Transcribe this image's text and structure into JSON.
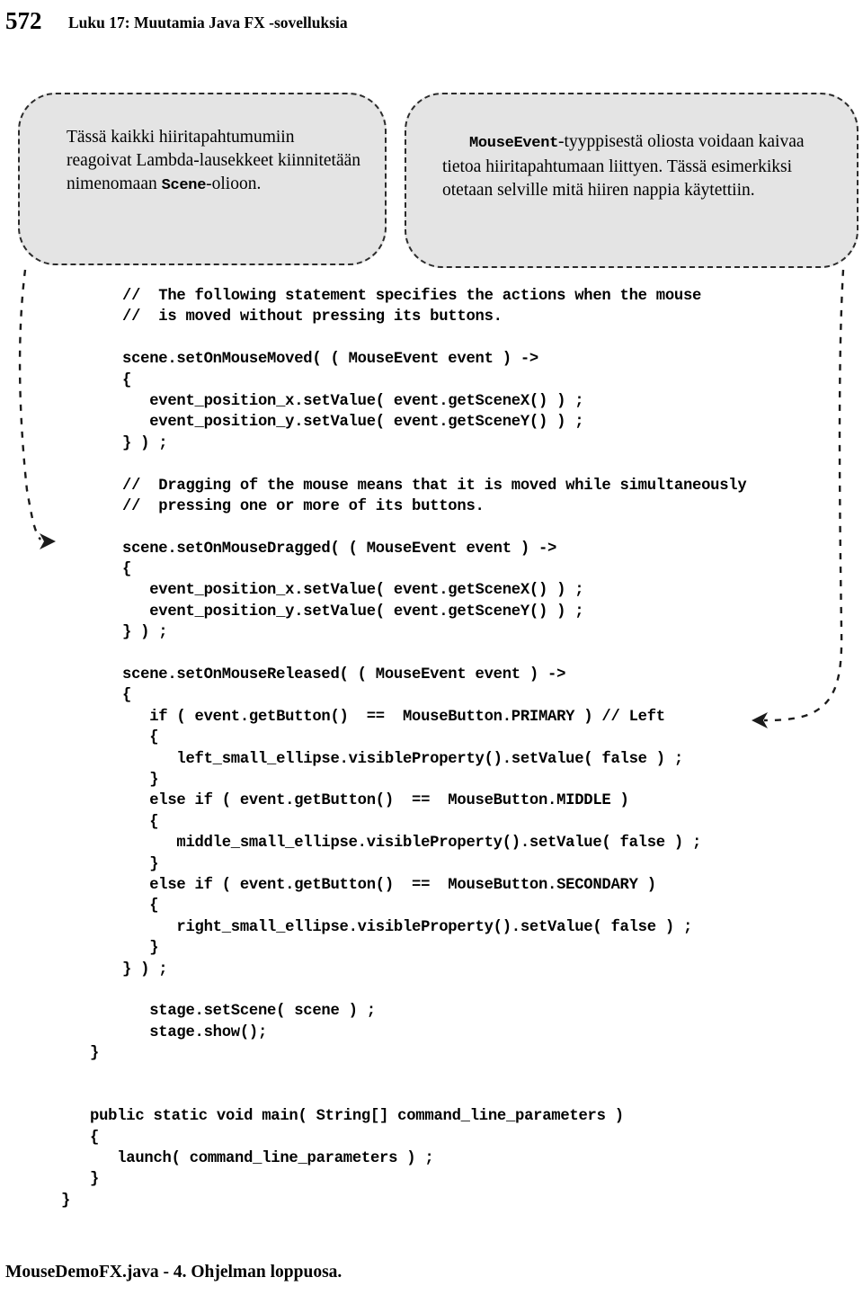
{
  "page": {
    "number": "572",
    "header_title": "Luku 17: Muutamia Java FX -sovelluksia",
    "footer_caption": "MouseDemoFX.java - 4.  Ohjelman loppuosa."
  },
  "callouts": {
    "left": {
      "text_part1": "    Tässä kaikki hiiritapahtumumiin reagoivat Lambda-lausekkeet kiinnitetään nimenomaan ",
      "code_term": "Scene",
      "text_part2": "-olioon."
    },
    "right": {
      "code_term": "MouseEvent",
      "text_part2": "-tyyppisestä oliosta voidaan kaivaa tietoa hiiritapahtumaan liittyen. Tässä esimerkiksi otetaan selville mitä hiiren nappia käytettiin."
    }
  },
  "code": {
    "lines": [
      {
        "text": "//  The following statement specifies the actions when the mouse",
        "indent": 0
      },
      {
        "text": "//  is moved without pressing its buttons.",
        "indent": 0
      },
      {
        "text": "",
        "indent": 0
      },
      {
        "text": "scene.setOnMouseMoved( ( MouseEvent event ) ->",
        "indent": 0
      },
      {
        "text": "{",
        "indent": 0
      },
      {
        "text": "   event_position_x.setValue( event.getSceneX() ) ;",
        "indent": 0
      },
      {
        "text": "   event_position_y.setValue( event.getSceneY() ) ;",
        "indent": 0
      },
      {
        "text": "} ) ;",
        "indent": 0
      },
      {
        "text": "",
        "indent": 0
      },
      {
        "text": "//  Dragging of the mouse means that it is moved while simultaneously",
        "indent": 0
      },
      {
        "text": "//  pressing one or more of its buttons.",
        "indent": 0
      },
      {
        "text": "",
        "indent": 0
      },
      {
        "text": "scene.setOnMouseDragged( ( MouseEvent event ) ->",
        "indent": 0
      },
      {
        "text": "{",
        "indent": 0
      },
      {
        "text": "   event_position_x.setValue( event.getSceneX() ) ;",
        "indent": 0
      },
      {
        "text": "   event_position_y.setValue( event.getSceneY() ) ;",
        "indent": 0
      },
      {
        "text": "} ) ;",
        "indent": 0
      },
      {
        "text": "",
        "indent": 0
      },
      {
        "text": "scene.setOnMouseReleased( ( MouseEvent event ) ->",
        "indent": 0
      },
      {
        "text": "{",
        "indent": 0
      },
      {
        "text": "   if ( event.getButton()  ==  MouseButton.PRIMARY ) // Left",
        "indent": 0
      },
      {
        "text": "   {",
        "indent": 0
      },
      {
        "text": "      left_small_ellipse.visibleProperty().setValue( false ) ;",
        "indent": 0
      },
      {
        "text": "   }",
        "indent": 0
      },
      {
        "text": "   else if ( event.getButton()  ==  MouseButton.MIDDLE )",
        "indent": 0
      },
      {
        "text": "   {",
        "indent": 0
      },
      {
        "text": "      middle_small_ellipse.visibleProperty().setValue( false ) ;",
        "indent": 0
      },
      {
        "text": "   }",
        "indent": 0
      },
      {
        "text": "   else if ( event.getButton()  ==  MouseButton.SECONDARY )",
        "indent": 0
      },
      {
        "text": "   {",
        "indent": 0
      },
      {
        "text": "      right_small_ellipse.visibleProperty().setValue( false ) ;",
        "indent": 0
      },
      {
        "text": "   }",
        "indent": 0
      },
      {
        "text": "} ) ;",
        "indent": 0
      },
      {
        "text": "",
        "indent": 0
      },
      {
        "text": "   stage.setScene( scene ) ;",
        "indent": 0
      },
      {
        "text": "   stage.show();",
        "indent": 0
      },
      {
        "text": "}",
        "indent": 1
      },
      {
        "text": "",
        "indent": 0
      },
      {
        "text": "",
        "indent": 0
      },
      {
        "text": "public static void main( String[] command_line_parameters )",
        "indent": 1
      },
      {
        "text": "{",
        "indent": 1
      },
      {
        "text": "   launch( command_line_parameters ) ;",
        "indent": 1
      },
      {
        "text": "}",
        "indent": 1
      },
      {
        "text": "}",
        "indent": 2
      }
    ]
  },
  "annotations": {
    "leader_left_label": "leader-line-left",
    "leader_right_label": "leader-line-right",
    "arrow_left_label": "arrowhead-right-pointing",
    "arrow_right_label": "arrowhead-left-pointing"
  }
}
